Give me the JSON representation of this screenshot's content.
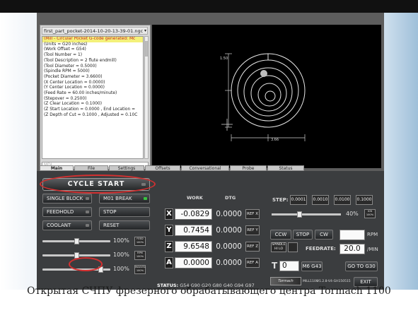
{
  "caption": "Открытая СЧПУ фрезерного обрабатывающего центра Tormach 1100",
  "gcode": {
    "filename": "first_part_pocket-2014-10-20-13-39-01.ngc",
    "lines": [
      "(Mill - Circular Pocket G-code generated: Mc",
      "",
      "(Units = G20 inches)",
      "(Work Offset = G54)",
      "(Tool Number = 1)",
      "(Tool Description = 2 flute endmill)",
      "(Tool Diameter = 0.5000)",
      "(Spindle RPM = 5000)",
      "",
      "(Pocket Diameter = 3.6600)",
      "(X Center Location = 0.0000)",
      "(Y Center Location = 0.0000)",
      "(Feed Rate = 60.00 inches/minute)",
      "(Stepover = 0.2500)",
      "",
      "(Z Clear Location = 0.1000)",
      "(Z Start Location = 0.0000 , End Location =",
      "(Z Depth of Cut = 0.1000 , Adjusted = 0.10C"
    ],
    "mdi_placeholder": "MDI"
  },
  "plot": {
    "dim_vertical": "1.50",
    "dim_horizontal": "3.66"
  },
  "tabs": [
    "Main",
    "File",
    "Settings",
    "Offsets",
    "Conversational",
    "Probe",
    "Status"
  ],
  "active_tab": "Main",
  "controls": {
    "cycle_start": "CYCLE START",
    "single_block": "SINGLE BLOCK",
    "m01_break": "M01 BREAK",
    "feedhold": "FEEDHOLD",
    "stop": "STOP",
    "coolant": "COOLANT",
    "reset": "RESET",
    "overrides": [
      {
        "value": "100%",
        "button": "FEED 100%",
        "level": 0.5
      },
      {
        "value": "100%",
        "button": "RPM 100%",
        "level": 0.5
      },
      {
        "value": "100%",
        "button": "MAXVEL 100%",
        "level": 0.85
      }
    ]
  },
  "dro": {
    "work_header": "WORK",
    "dtg_header": "DTG",
    "axes": [
      {
        "axis": "X",
        "work": "-0.0829",
        "dtg": "0.0000",
        "ref": "REF X"
      },
      {
        "axis": "Y",
        "work": "0.7454",
        "dtg": "0.0000",
        "ref": "REF Y"
      },
      {
        "axis": "Z",
        "work": "9.6548",
        "dtg": "0.0000",
        "ref": "REF Z"
      },
      {
        "axis": "A",
        "work": "0.0000",
        "dtg": "0.0000",
        "ref": "REF A"
      }
    ],
    "status_label": "STATUS:",
    "status_codes": "G54 G90 G20 G80 G40 G94 G97"
  },
  "spindle": {
    "step_label": "STEP:",
    "steps": [
      "0.0001",
      "0.0010",
      "0.0100",
      "0.1000"
    ],
    "rpm_pct": "40%",
    "rpm_level": 0.4,
    "ccw": "CCW",
    "stop": "STOP",
    "cw": "CW",
    "rpm_unit": "RPM",
    "spindle_range": "SPINDLE HI LO",
    "feedrate_label": "FEEDRATE:",
    "feedrate_value": "20.0",
    "feedrate_unit": "/MIN",
    "tool_label": "T",
    "tool_value": "0",
    "m6_g43": "M6 G43",
    "goto": "GO TO G30",
    "exit": "EXIT",
    "logo": "Tormach",
    "model": "MILL1100",
    "version": "V1.2.8-V4-GH150515"
  },
  "colors": {
    "highlight": "#f4f17a",
    "annotation": "#d43030",
    "led_on": "#39c341"
  }
}
